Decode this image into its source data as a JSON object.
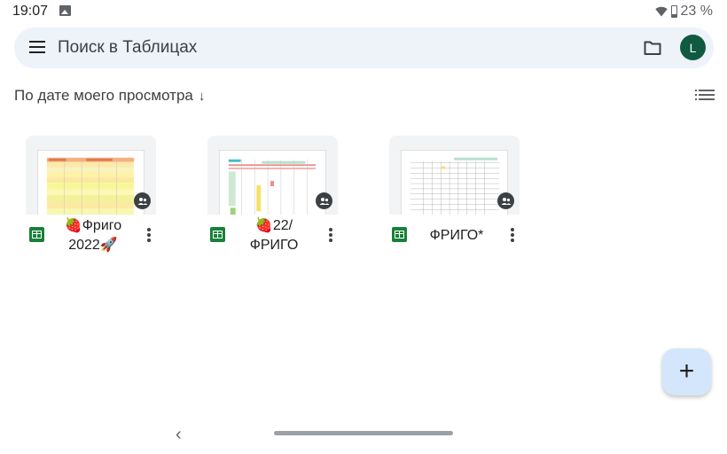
{
  "status_bar": {
    "time": "19:07",
    "battery": "23 %",
    "icons": [
      "image-notification-icon",
      "wifi-icon",
      "battery-icon"
    ]
  },
  "search": {
    "placeholder": "Поиск в Таблицах",
    "avatar_initial": "L",
    "avatar_color": "#0f5a40"
  },
  "sort": {
    "label": "По дате моего просмотра",
    "arrow": "↓"
  },
  "files": [
    {
      "name_line1": "🍓Фриго",
      "name_line2": "2022🚀",
      "shared": true
    },
    {
      "name_line1": "🍓22/",
      "name_line2": "ФРИГО",
      "shared": true
    },
    {
      "name_line1": "ФРИГО*",
      "name_line2": "",
      "shared": true
    }
  ],
  "fab": {
    "symbol": "+",
    "color": "#d3e6fb"
  },
  "nav": {
    "back_symbol": "‹"
  },
  "colors": {
    "sheets_green": "#188038",
    "search_bg": "#eef2f9"
  }
}
